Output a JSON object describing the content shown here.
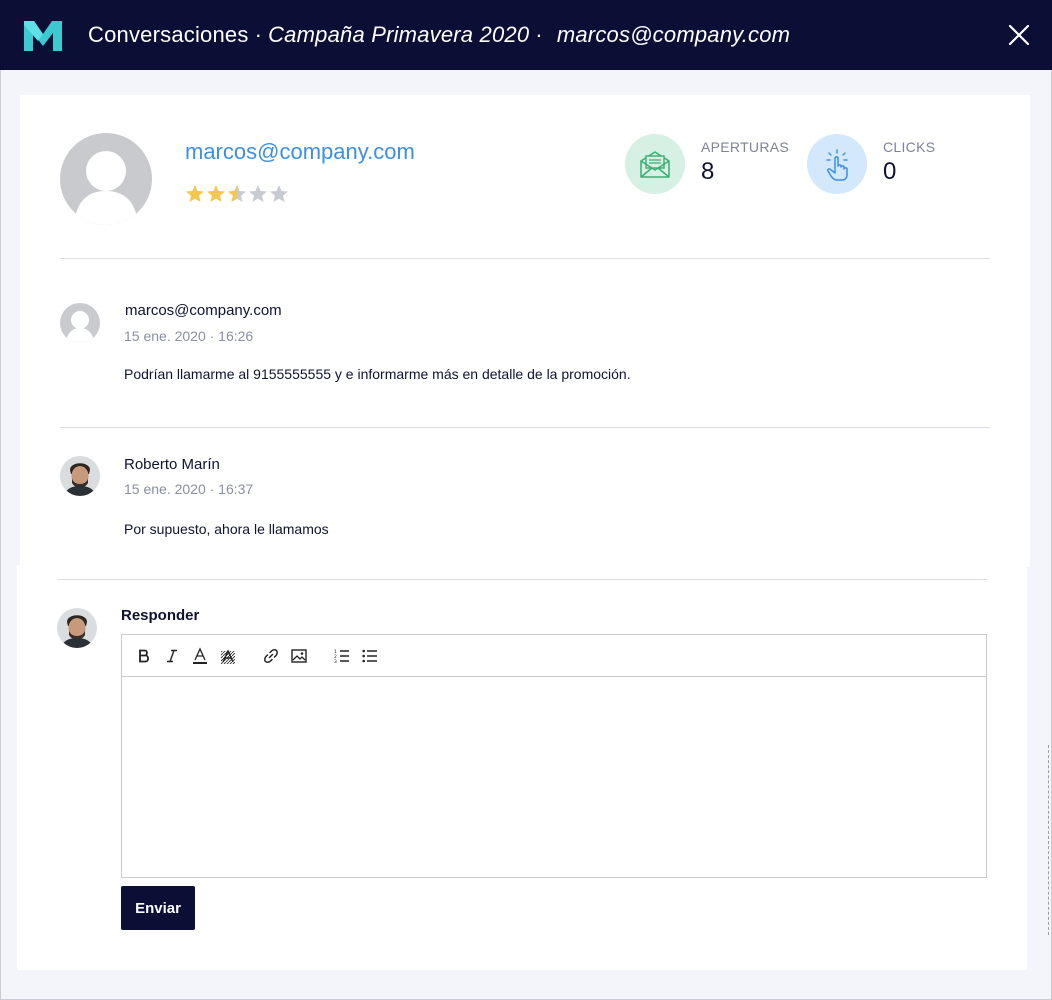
{
  "header": {
    "section": "Conversaciones",
    "separator": "·",
    "campaign": "Campaña Primavera 2020",
    "separator2": "·",
    "contact": "marcos@company.com"
  },
  "contact": {
    "email": "marcos@company.com",
    "rating": 2.5,
    "rating_max": 5
  },
  "stats": {
    "opens_label": "APERTURAS",
    "opens_value": "8",
    "clicks_label": "CLICKS",
    "clicks_value": "0"
  },
  "messages": [
    {
      "author": "marcos@company.com",
      "time": "15 ene. 2020 · 16:26",
      "text": "Podrían llamarme al 9155555555 y e informarme más en detalle de la promoción."
    },
    {
      "author": "Roberto Marín",
      "time": "15 ene. 2020 · 16:37",
      "text": "Por supuesto, ahora le llamamos"
    }
  ],
  "reply": {
    "label": "Responder",
    "send_label": "Enviar",
    "toolbar_icons": [
      "bold-icon",
      "italic-icon",
      "text-color-icon",
      "highlight-icon",
      "link-icon",
      "image-icon",
      "ordered-list-icon",
      "bullet-list-icon"
    ]
  },
  "colors": {
    "header_bg": "#0b0e35",
    "accent_blue": "#3d8fe0",
    "star_filled": "#f4c84f",
    "star_empty": "#c9cbd3",
    "opens_bg": "#d6f1e3",
    "clicks_bg": "#d4e8fb"
  }
}
